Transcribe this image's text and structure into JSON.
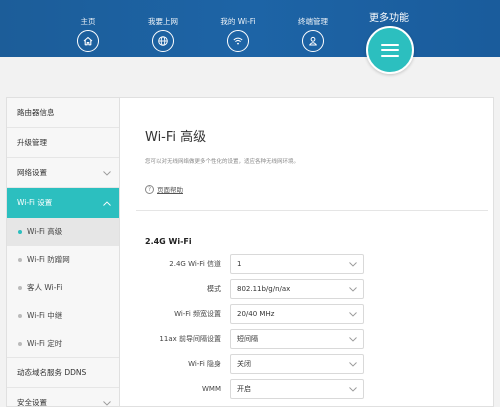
{
  "header": {
    "nav": [
      {
        "label": "主页",
        "icon": "home-icon"
      },
      {
        "label": "我要上网",
        "icon": "globe-icon"
      },
      {
        "label": "我的 Wi-Fi",
        "icon": "wifi-icon"
      },
      {
        "label": "终端管理",
        "icon": "user-icon"
      }
    ],
    "more_label": "更多功能",
    "more_icon": "menu-icon",
    "colors": {
      "bar": "#1d64a6",
      "accent": "#2cbfbf"
    }
  },
  "sidebar": {
    "items": [
      {
        "label": "路由器信息"
      },
      {
        "label": "升级管理"
      },
      {
        "label": "网络设置",
        "expandable": true
      },
      {
        "label": "Wi-Fi 设置",
        "expandable": true,
        "active": true
      }
    ],
    "sub_items": [
      {
        "label": "Wi-Fi 高级",
        "current": true
      },
      {
        "label": "Wi-Fi 防蹭网"
      },
      {
        "label": "客人 Wi-Fi"
      },
      {
        "label": "Wi-Fi 中继"
      },
      {
        "label": "Wi-Fi 定时"
      }
    ],
    "after_items": [
      {
        "label": "动态域名服务 DDNS"
      },
      {
        "label": "安全设置",
        "expandable": true
      }
    ]
  },
  "main": {
    "title": "Wi-Fi 高级",
    "description": "您可以对无线网络做更多个性化的设置，适应各种无线网环境。",
    "help_label": "页面帮助",
    "section_title": "2.4G Wi-Fi",
    "fields": [
      {
        "label": "2.4G Wi-Fi 信道",
        "value": "1"
      },
      {
        "label": "模式",
        "value": "802.11b/g/n/ax"
      },
      {
        "label": "Wi-Fi 频宽设置",
        "value": "20/40 MHz"
      },
      {
        "label": "11ax 前导间隔设置",
        "value": "短间隔"
      },
      {
        "label": "Wi-Fi 隐身",
        "value": "关闭"
      },
      {
        "label": "WMM",
        "value": "开启"
      }
    ]
  }
}
